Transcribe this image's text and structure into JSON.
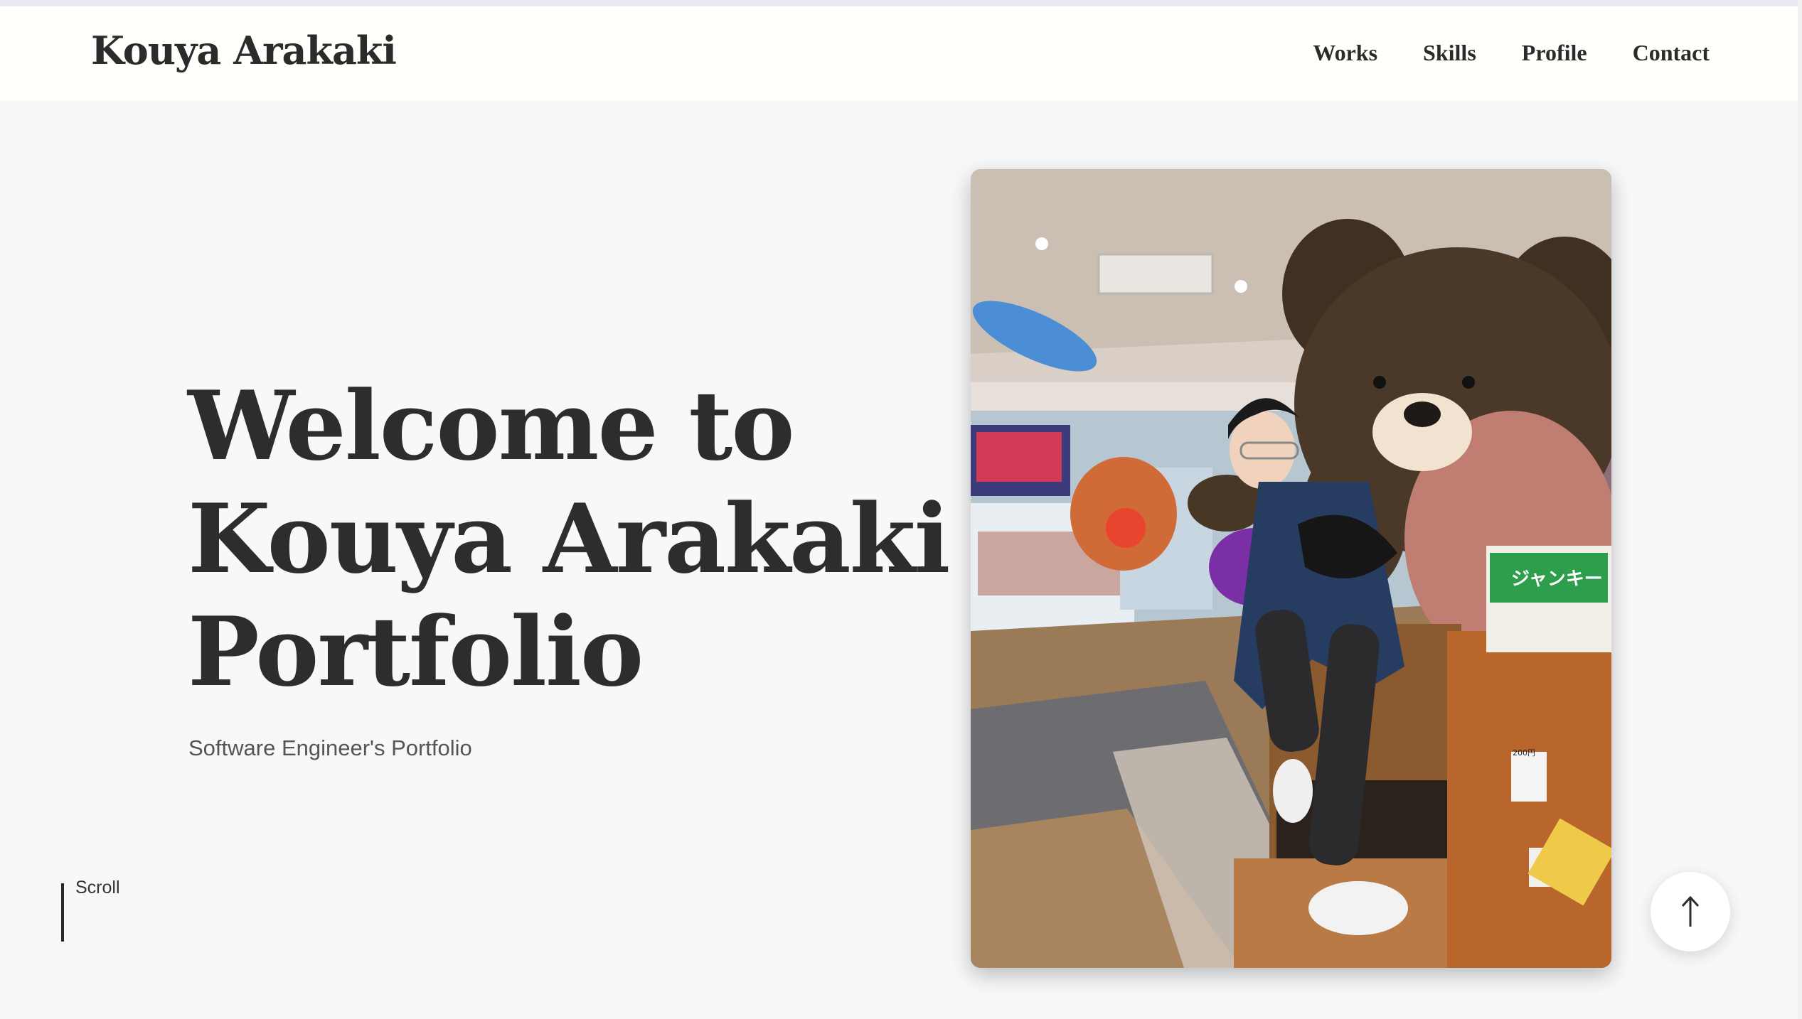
{
  "header": {
    "logo": "Kouya Arakaki",
    "nav": [
      {
        "label": "Works"
      },
      {
        "label": "Skills"
      },
      {
        "label": "Profile"
      },
      {
        "label": "Contact"
      }
    ]
  },
  "hero": {
    "title_lines": [
      "Welcome to",
      "Kouya Arakaki",
      "Portfolio"
    ],
    "subtitle": "Software Engineer's Portfolio",
    "scroll_label": "Scroll"
  },
  "photo": {
    "sign_text": "ジャンキー",
    "price_label": "200円"
  },
  "colors": {
    "text_dark": "#2b2b2b",
    "page_bg": "#f7f8fa",
    "header_bg": "#fffffb"
  }
}
